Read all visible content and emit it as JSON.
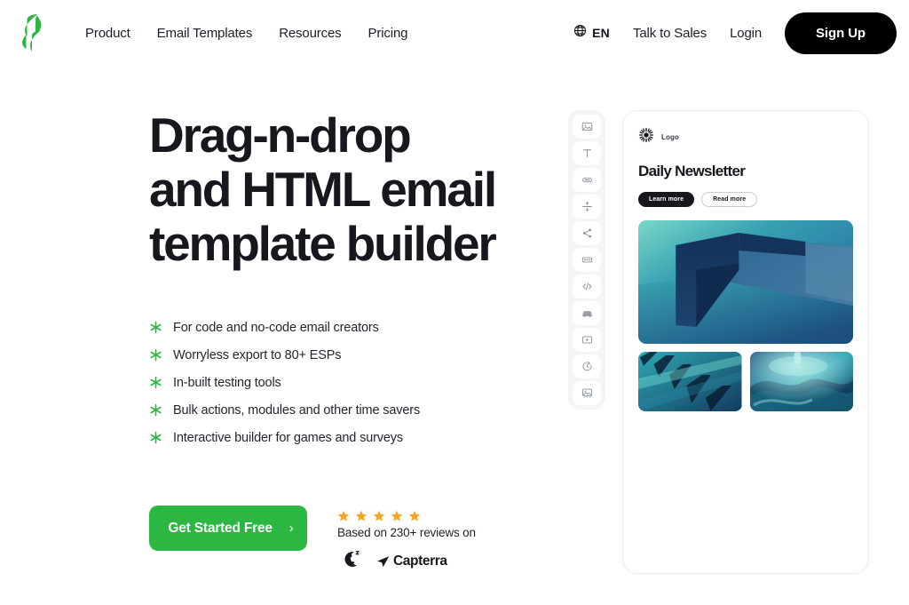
{
  "brand": {
    "logo_icon": "stripo-s-logo-icon",
    "accent_green": "#2cb742",
    "ink": "#16181d"
  },
  "header": {
    "nav": [
      {
        "label": "Product",
        "name": "nav-link-product"
      },
      {
        "label": "Email Templates",
        "name": "nav-link-email-templates"
      },
      {
        "label": "Resources",
        "name": "nav-link-resources"
      },
      {
        "label": "Pricing",
        "name": "nav-link-pricing"
      }
    ],
    "language": {
      "icon": "globe-icon",
      "label": "EN"
    },
    "talk_to_sales": "Talk to Sales",
    "login": "Login",
    "signup": "Sign Up"
  },
  "hero": {
    "headline_lines": [
      "Drag-n-drop",
      "and HTML email",
      "template builder"
    ],
    "features": [
      "For code and no-code email creators",
      "Worryless export to 80+ ESPs",
      "In-built testing tools",
      "Bulk actions, modules and other time savers",
      "Interactive builder for games and surveys"
    ],
    "bullet_icon": "asterisk-icon",
    "cta": {
      "label": "Get Started Free",
      "arrow": "›"
    },
    "reviews": {
      "star_count": 5,
      "star_color": "#f5a623",
      "text": "Based on 230+ reviews on",
      "brands": [
        {
          "name": "g2-logo",
          "label": "G2"
        },
        {
          "name": "capterra-logo",
          "label": "Capterra"
        }
      ]
    }
  },
  "builder_toolbar": {
    "tools": [
      {
        "name": "image-block-icon",
        "title": "Image"
      },
      {
        "name": "text-block-icon",
        "title": "Text"
      },
      {
        "name": "button-block-icon",
        "title": "Button"
      },
      {
        "name": "spacer-block-icon",
        "title": "Spacer"
      },
      {
        "name": "social-share-icon",
        "title": "Social"
      },
      {
        "name": "menu-block-icon",
        "title": "Menu"
      },
      {
        "name": "html-code-icon",
        "title": "HTML"
      },
      {
        "name": "banner-block-icon",
        "title": "Banner"
      },
      {
        "name": "video-block-icon",
        "title": "Video"
      },
      {
        "name": "timer-block-icon",
        "title": "Timer"
      },
      {
        "name": "gallery-block-icon",
        "title": "Gallery"
      }
    ]
  },
  "email_preview": {
    "logo": {
      "icon": "sunburst-logo-icon",
      "label": "Logo"
    },
    "title": "Daily Newsletter",
    "buttons": [
      {
        "label": "Learn more",
        "style": "dark"
      },
      {
        "label": "Read more",
        "style": "ghost"
      }
    ],
    "images": [
      {
        "name": "hero-gradient-room-image",
        "alt": "abstract teal room"
      },
      {
        "name": "thumb-stairs-image",
        "alt": "abstract blue stairs"
      },
      {
        "name": "thumb-glass-image",
        "alt": "abstract teal glass"
      }
    ]
  }
}
